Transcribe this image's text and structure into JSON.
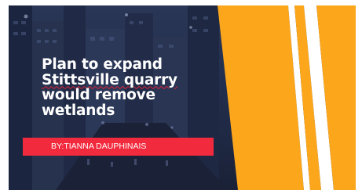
{
  "headline": {
    "line1": "Plan to expand",
    "line2": "Stittsville quarry",
    "line3": "would remove",
    "line4": "wetlands"
  },
  "byline": "BY:TIANNA DAUPHINAIS",
  "colors": {
    "accent": "#f22a3d",
    "stripe": "#fca61c",
    "overlay": "#26324f",
    "text": "#ffffff"
  }
}
